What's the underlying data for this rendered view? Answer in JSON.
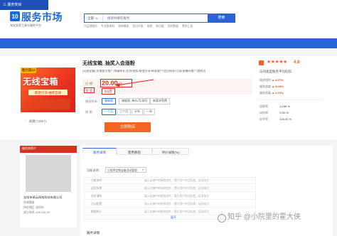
{
  "header": {
    "logo_text": "服务市场",
    "logo_badge": "10",
    "logo_sub": "淘宝卖家工具与服务平台",
    "search_category": "全部",
    "search_placeholder": "搜索你要的服务",
    "search_button": "搜索",
    "hot_words": [
      "代运营服务",
      "专业版带机",
      "装修模板",
      "会员升级",
      "电商",
      "新功能",
      "实时数据",
      "营销工具"
    ]
  },
  "nav": {
    "items": [
      "三 服务类目",
      "代运营",
      "营销推广",
      "短视频服务",
      "购物小程序",
      "客服外包",
      "摄影市场",
      "装修设计",
      "知识产权"
    ]
  },
  "product": {
    "image_badge": "助力双12",
    "image_title": "无线宝箱",
    "image_tag": "裂变引流 抽奖互动",
    "favorite_label": "收藏(72067)",
    "title": "无线宝箱_抽奖入会涨粉",
    "description": "[无线宝箱] 店铺首页推广/收藏有礼/签到/抽奖/裂变分享/新老客户/会员粉丝/引流/直播间推广/视频页",
    "price_label": "价 格:",
    "price_value": "20.00",
    "price_unit": "元",
    "qty_label": "销 量:",
    "qty_value": "3.1万",
    "version_label": "服务版本:",
    "versions": [
      "基础版",
      "旗舰版_单价/月/双旺",
      "新版本免费"
    ],
    "period_label": "周 期:",
    "periods": [
      "一个月",
      "三个月",
      "半年",
      "一年"
    ],
    "cta": "立即购买"
  },
  "shop": {
    "stars": "★★★★★",
    "score": "4.8",
    "note": "与同类型服务平均比较",
    "ratings": [
      {
        "label": "描述相符",
        "value": "4.27%"
      },
      {
        "label": "服务态度",
        "value": "3.49%"
      },
      {
        "label": "服务质量",
        "value": "2.72%"
      }
    ],
    "stats": [
      {
        "label": "退款率:",
        "value": "12.66 %"
      },
      {
        "label": "纠纷率:",
        "value": "0.00 %"
      },
      {
        "label": "好评率:",
        "value": "100.00 %"
      }
    ]
  },
  "shop_card": {
    "head": "服务商简介",
    "name": "金阳市易云网络科技有限公司",
    "lines": [
      "在线客服",
      "所在地区: 金阳市",
      "成立时间: 2012-09-09"
    ]
  },
  "tabs": [
    "服务详情",
    "使用教程",
    "评价详情(%)"
  ],
  "filter": {
    "label": "功能说明:",
    "selected": "小程序定制宝箱活动管理"
  },
  "table_rows": [
    {
      "a": "功能说明",
      "b": "展示店铺中的装修组件，提升用户的活跃度，促进成交"
    },
    {
      "a": "适用场景",
      "b": "展示店铺中的装修组件，提升用户的活跃度，促进成交"
    },
    {
      "a": "短信通知",
      "b": "展示店铺中的装修组件，提升用户的活跃度，促进成交"
    },
    {
      "a": "活动配置",
      "b": "展示店铺中的装修组件，提升用户的活跃度，促进成交"
    },
    {
      "a": "数据统计",
      "b": "展示店铺中的装修组件，提升用户的活跃度，促进成交"
    }
  ],
  "expand_label": "展开",
  "bottom_label": "服务详情",
  "watermark": "知乎 @小院里的霍大侠",
  "colors": {
    "brand": "#2b62d4",
    "accent": "#f26522",
    "price": "#e43b1a"
  }
}
